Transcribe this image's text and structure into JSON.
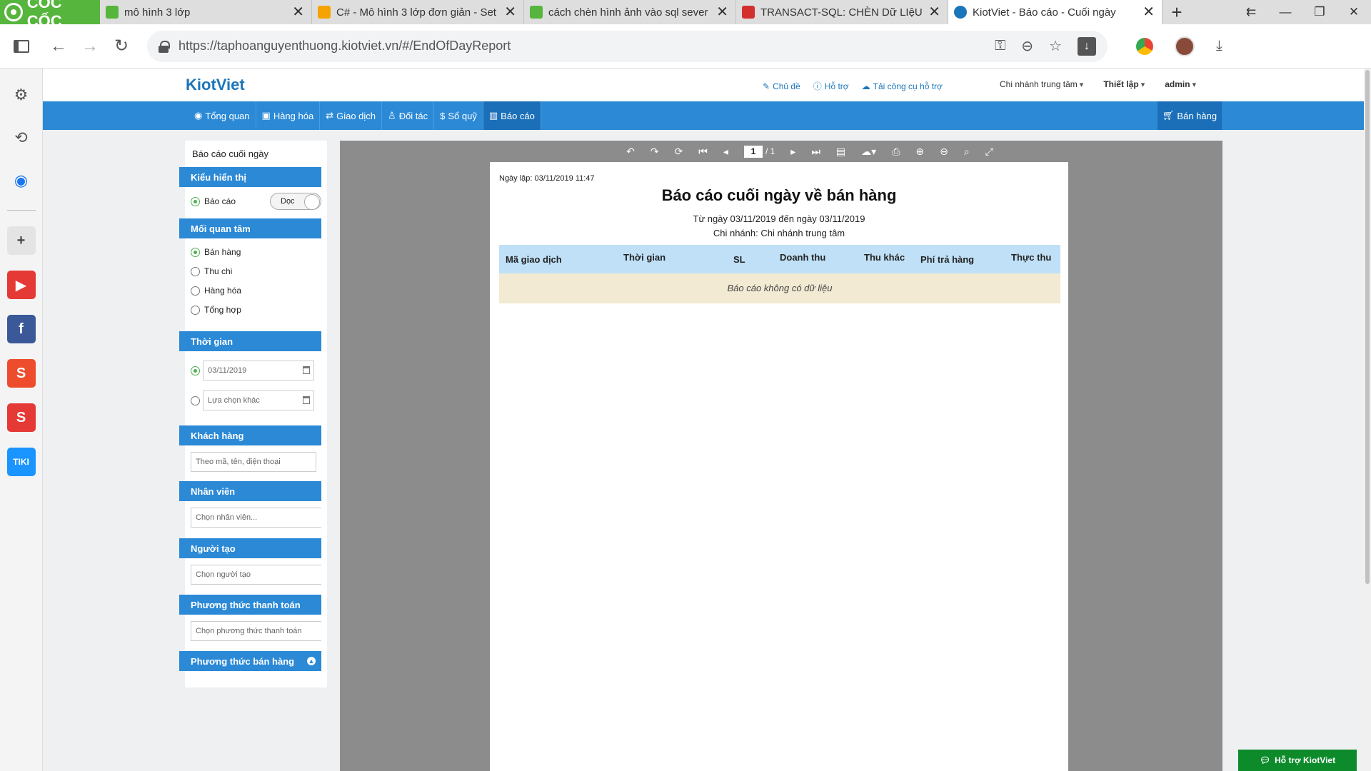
{
  "browser": {
    "logo_text": "CỐC CỐC",
    "tabs": [
      {
        "title": "mô hình 3 lớp",
        "favicon_color": "#56b53c"
      },
      {
        "title": "C# - Mô hình 3 lớp đơn giản - Set",
        "favicon_color": "#f4a300"
      },
      {
        "title": "cách chèn hình ảnh vào sql sever",
        "favicon_color": "#56b53c"
      },
      {
        "title": "TRANSACT-SQL: CHÈN Dữ LIệU H",
        "favicon_color": "#d32f2f"
      },
      {
        "title": "KiotViet - Báo cáo - Cuối ngày",
        "favicon_color": "#1b75bb"
      }
    ],
    "url": "https://taphoanguyenthuong.kiotviet.vn/#/EndOfDayReport"
  },
  "kiotviet": {
    "logo": "KiotViet",
    "header_links": [
      "Chủ đề",
      "Hỗ trợ",
      "Tải công cụ hỗ trợ"
    ],
    "branch_menu": "Chi nhánh trung tâm",
    "settings_menu": "Thiết lập",
    "user_menu": "admin",
    "nav": [
      "Tổng quan",
      "Hàng hóa",
      "Giao dịch",
      "Đối tác",
      "Sổ quỹ",
      "Báo cáo"
    ],
    "sell_button": "Bán hàng"
  },
  "filters": {
    "title": "Báo cáo cuối ngày",
    "display_head": "Kiểu hiển thị",
    "display_option": "Báo cáo",
    "display_toggle": "Dọc",
    "concern_head": "Mối quan tâm",
    "concern_options": [
      "Bán hàng",
      "Thu chi",
      "Hàng hóa",
      "Tổng hợp"
    ],
    "time_head": "Thời gian",
    "date_value": "03/11/2019",
    "date_other": "Lựa chọn khác",
    "customer_head": "Khách hàng",
    "customer_placeholder": "Theo mã, tên, điện thoại",
    "staff_head": "Nhân viên",
    "staff_placeholder": "Chọn nhân viên...",
    "creator_head": "Người tạo",
    "creator_placeholder": "Chọn người tạo",
    "payment_head": "Phương thức thanh toán",
    "payment_placeholder": "Chọn phương thức thanh toán",
    "sales_method_head": "Phương thức bán hàng"
  },
  "viewer": {
    "page_current": "1",
    "page_total": "/ 1"
  },
  "report": {
    "created": "Ngày lập: 03/11/2019 11:47",
    "title": "Báo cáo cuối ngày về bán hàng",
    "date_range": "Từ ngày 03/11/2019 đến ngày 03/11/2019",
    "branch": "Chi nhánh: Chi nhánh trung tâm",
    "columns": [
      "Mã giao dịch",
      "Thời gian",
      "SL",
      "Doanh thu",
      "Thu khác",
      "Phí trả hàng",
      "Thực thu"
    ],
    "empty": "Báo cáo không có dữ liệu"
  },
  "support_button": "Hỗ trợ KiotViet"
}
